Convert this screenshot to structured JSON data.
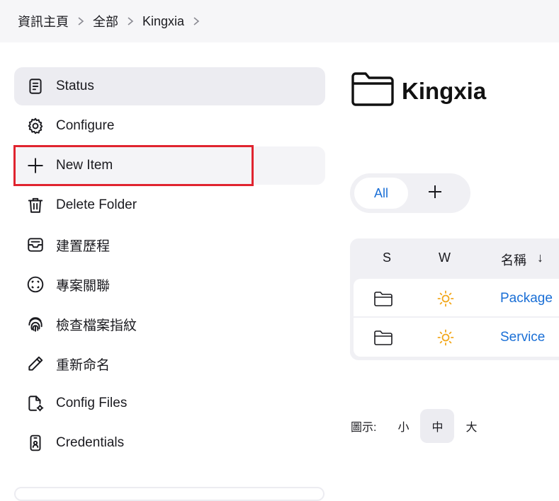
{
  "breadcrumb": [
    "資訊主頁",
    "全部",
    "Kingxia"
  ],
  "sidebar": {
    "items": [
      {
        "label": "Status",
        "icon": "document-icon"
      },
      {
        "label": "Configure",
        "icon": "gear-icon"
      },
      {
        "label": "New Item",
        "icon": "plus-icon"
      },
      {
        "label": "Delete Folder",
        "icon": "trash-icon"
      },
      {
        "label": "建置歷程",
        "icon": "inbox-icon"
      },
      {
        "label": "專案關聯",
        "icon": "relations-icon"
      },
      {
        "label": "檢查檔案指紋",
        "icon": "fingerprint-icon"
      },
      {
        "label": "重新命名",
        "icon": "pencil-icon"
      },
      {
        "label": "Config Files",
        "icon": "config-file-icon"
      },
      {
        "label": "Credentials",
        "icon": "id-badge-icon"
      }
    ]
  },
  "main": {
    "title": "Kingxia",
    "tabs": {
      "all": "All"
    },
    "table": {
      "headers": {
        "s": "S",
        "w": "W",
        "name": "名稱",
        "sort": "↓"
      },
      "rows": [
        {
          "name": "Package"
        },
        {
          "name": "Service"
        }
      ]
    },
    "icon_size": {
      "label": "圖示:",
      "small": "小",
      "medium": "中",
      "large": "大",
      "selected": "中"
    }
  },
  "colors": {
    "link": "#1a6fd6",
    "highlight": "#e0242f",
    "sun": "#f2a81d"
  }
}
